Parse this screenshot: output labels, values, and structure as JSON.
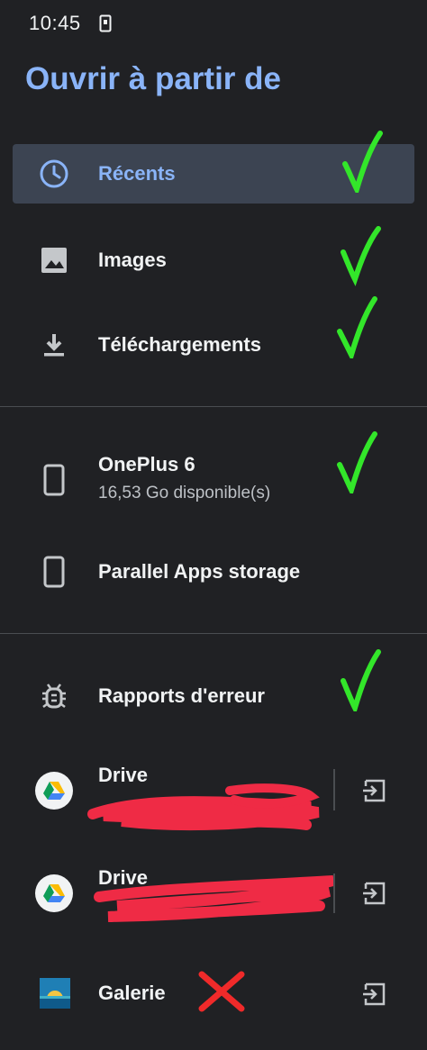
{
  "status_bar": {
    "time": "10:45",
    "icon": "screenshot-device-icon"
  },
  "title": "Ouvrir à partir de",
  "colors": {
    "accent": "#8ab4f8",
    "background": "#202124",
    "selected_row": "#3c4452",
    "check_mark": "#33e62a",
    "cross_mark": "#f02a2a",
    "redaction": "#ef2b45"
  },
  "items": [
    {
      "label": "Récents",
      "icon": "clock-icon",
      "selected": true,
      "marked": "check"
    },
    {
      "label": "Images",
      "icon": "image-icon",
      "marked": "check"
    },
    {
      "label": "Téléchargements",
      "icon": "download-icon",
      "marked": "check"
    },
    {
      "label": "OnePlus 6",
      "sub": "16,53 Go disponible(s)",
      "icon": "phone-icon",
      "marked": "check"
    },
    {
      "label": "Parallel Apps storage",
      "icon": "phone-icon"
    },
    {
      "label": "Rapports d'erreur",
      "icon": "bug-icon",
      "marked": "check"
    },
    {
      "label": "Drive",
      "icon": "google-drive-icon",
      "action": "eject-icon",
      "sub_redacted": true
    },
    {
      "label": "Drive",
      "icon": "google-drive-icon",
      "action": "eject-icon",
      "sub_redacted": true
    },
    {
      "label": "Galerie",
      "icon": "gallery-app-icon",
      "action": "eject-icon",
      "marked": "cross"
    }
  ]
}
